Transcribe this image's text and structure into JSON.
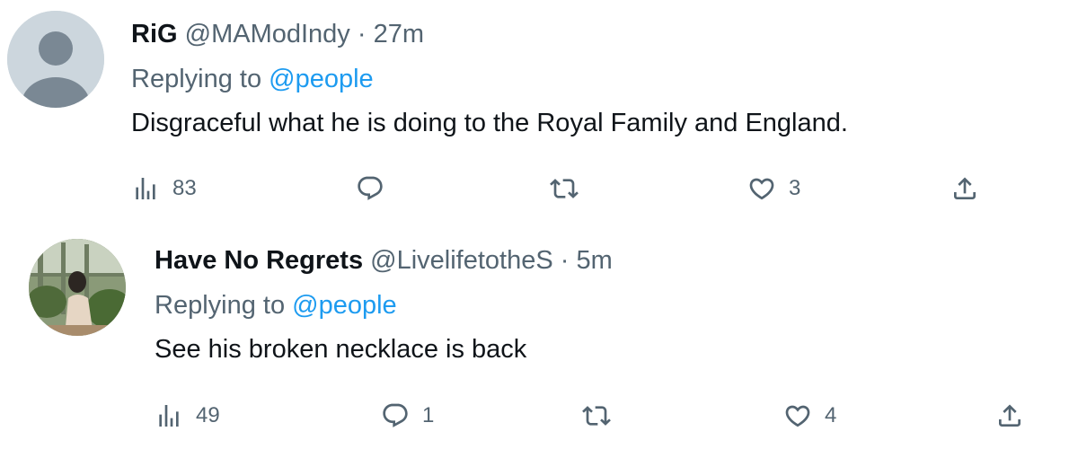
{
  "tweets": [
    {
      "display_name": "RiG",
      "handle": "@MAModIndy",
      "separator": "·",
      "time": "27m",
      "replying_label": "Replying to",
      "replying_mention": "@people",
      "text": "Disgraceful what he is doing to the Royal Family and England.",
      "views": "83",
      "replies": "",
      "retweets": "",
      "likes": "3",
      "avatar_icon": "default-profile-icon"
    },
    {
      "display_name": "Have No Regrets",
      "handle": "@LivelifetotheS",
      "separator": "·",
      "time": "5m",
      "replying_label": "Replying to",
      "replying_mention": "@people",
      "text": "See his broken necklace is back",
      "views": "49",
      "replies": "1",
      "retweets": "",
      "likes": "4",
      "avatar_icon": "profile-photo"
    }
  ],
  "colors": {
    "primary_text": "#0f1419",
    "secondary_text": "#536471",
    "accent": "#1d9bf0"
  }
}
